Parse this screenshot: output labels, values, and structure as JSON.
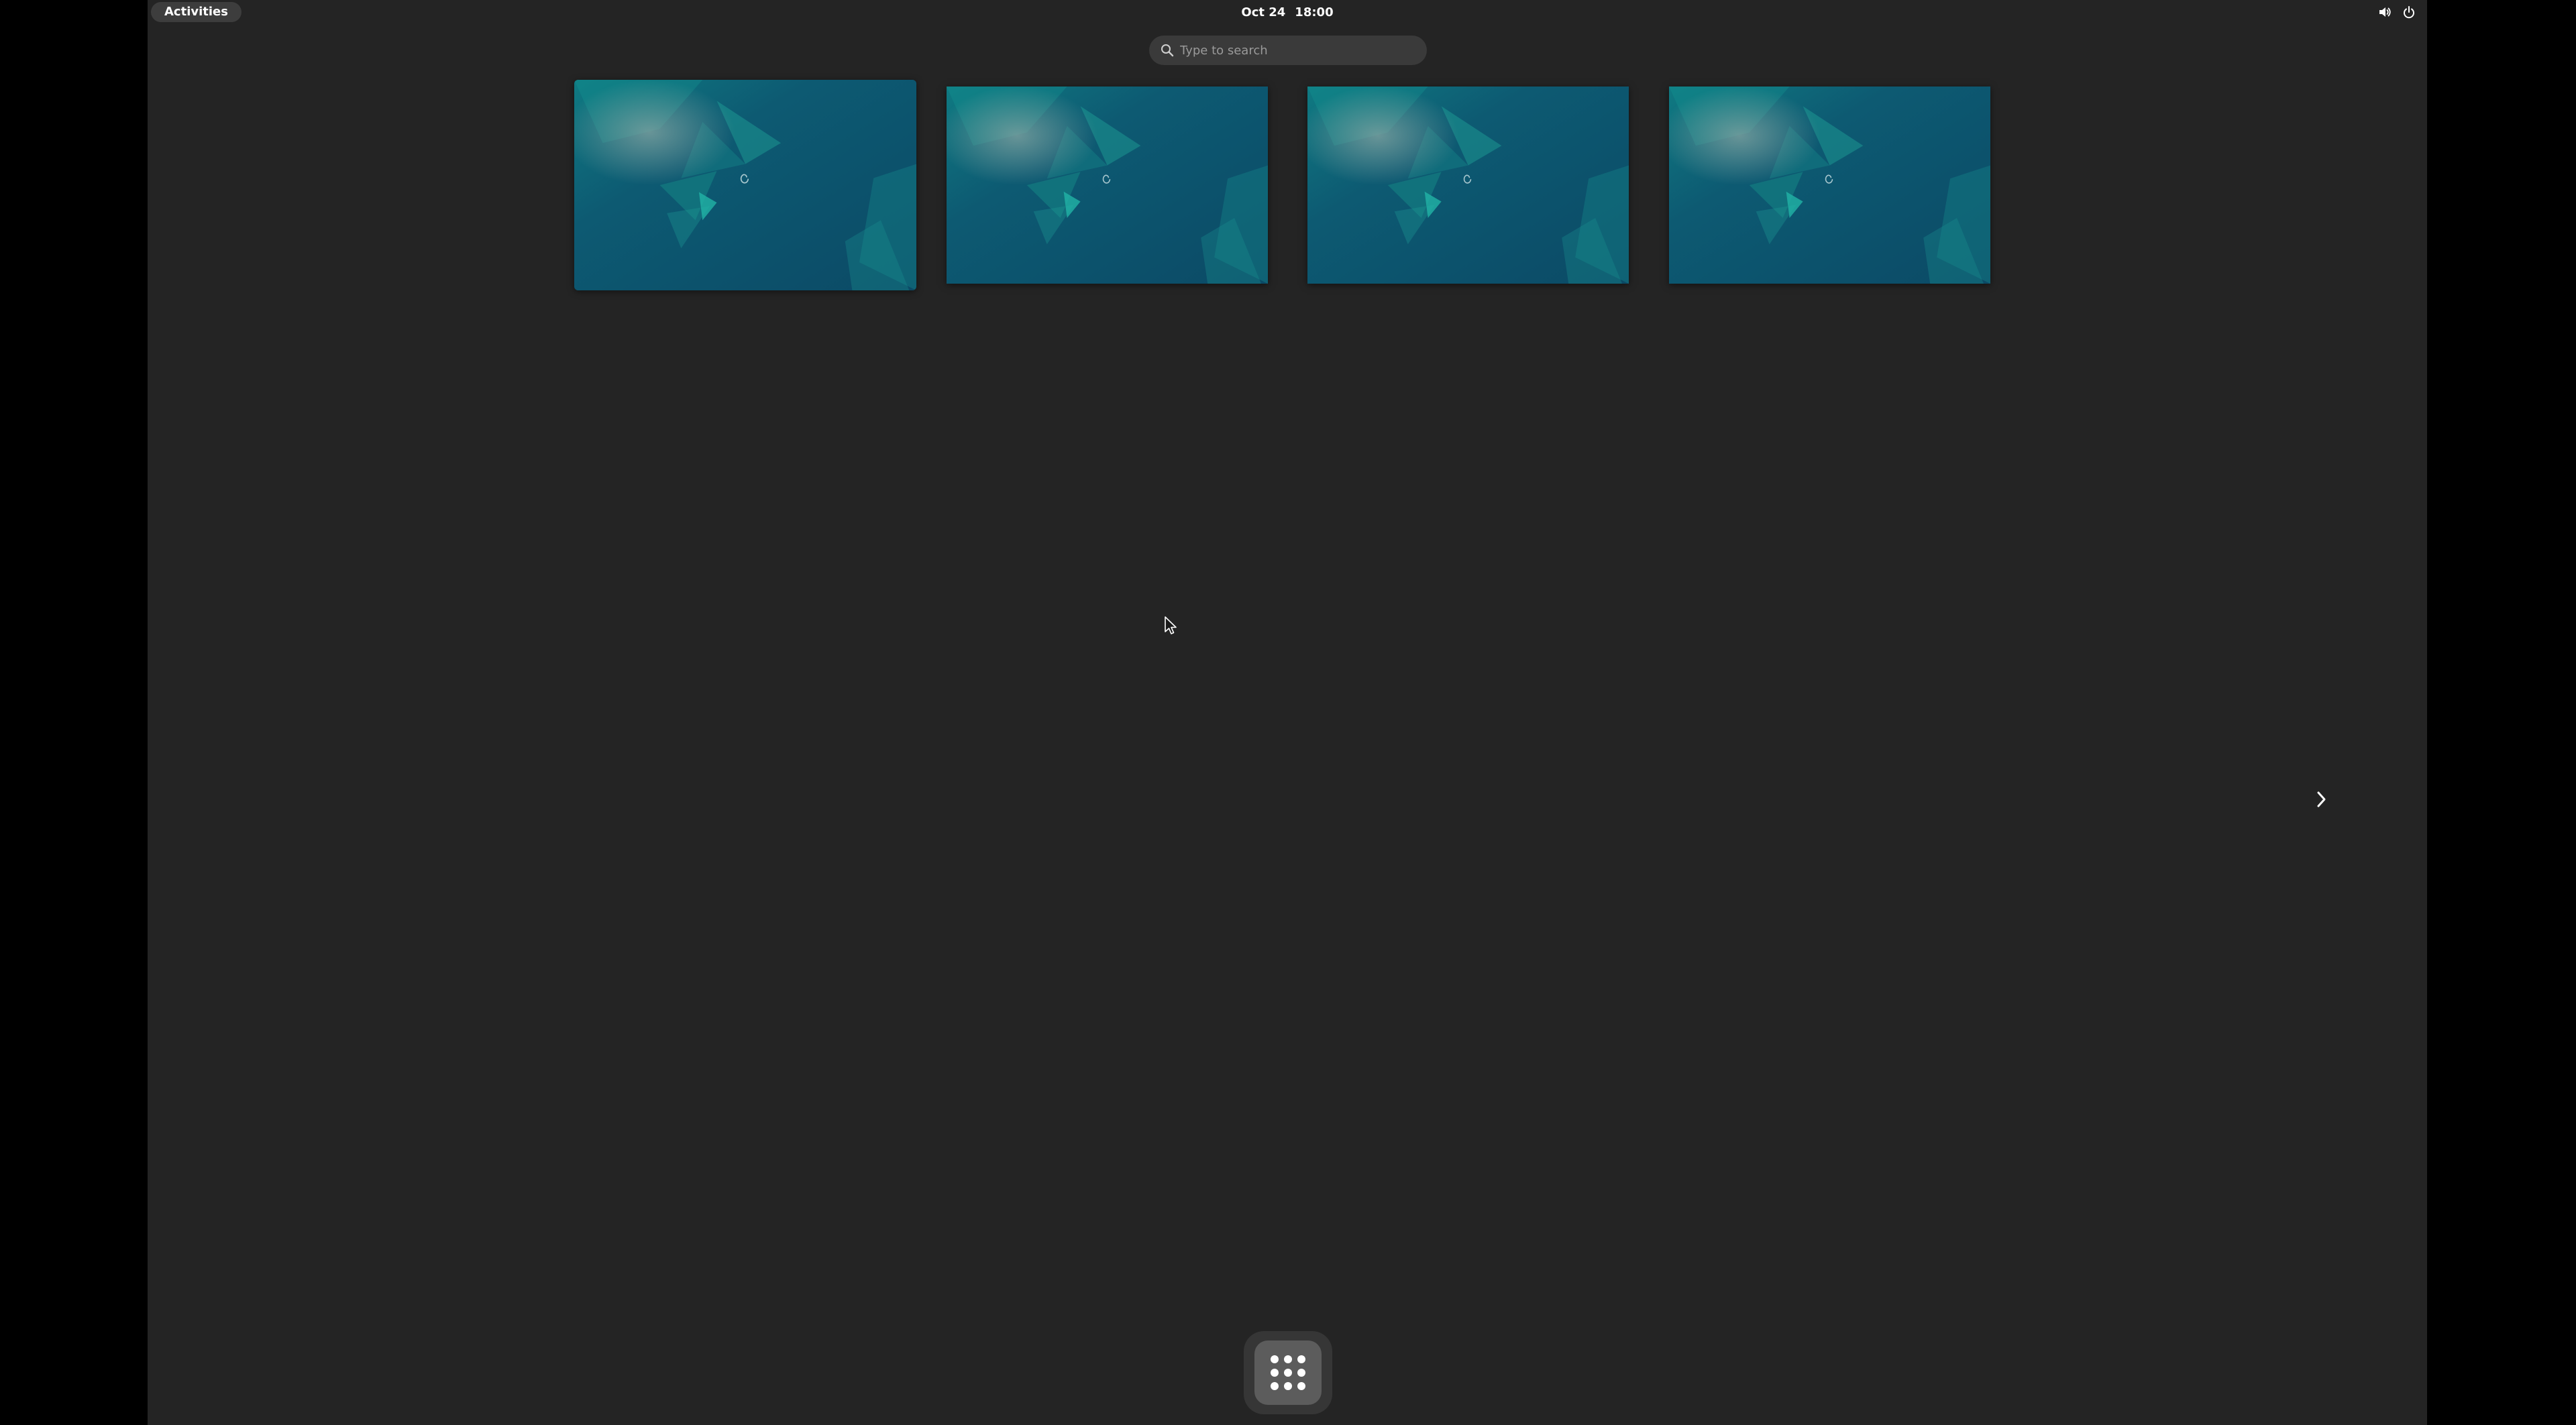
{
  "topbar": {
    "activities_label": "Activities",
    "date": "Oct 24",
    "time": "18:00",
    "status_icons": [
      "volume-icon",
      "power-icon"
    ]
  },
  "search": {
    "placeholder": "Type to search"
  },
  "workspaces": [
    {
      "name": "workspace-1",
      "active": true
    },
    {
      "name": "workspace-2",
      "active": false
    },
    {
      "name": "workspace-3",
      "active": false
    },
    {
      "name": "workspace-4",
      "active": false
    }
  ],
  "navigation": {
    "next_icon": "chevron-right-icon"
  },
  "dash": {
    "apps_icon": "app-grid-icon"
  },
  "colors": {
    "background": "#242424",
    "screen_border": "#000000",
    "wallpaper_base": "#0e4d66",
    "wallpaper_accent": "#1a8a8a",
    "search_bg": "#3a3a3a",
    "dash_bg": "#363636",
    "app_grid_button_bg": "#5c5c5c",
    "text": "#ffffff"
  }
}
